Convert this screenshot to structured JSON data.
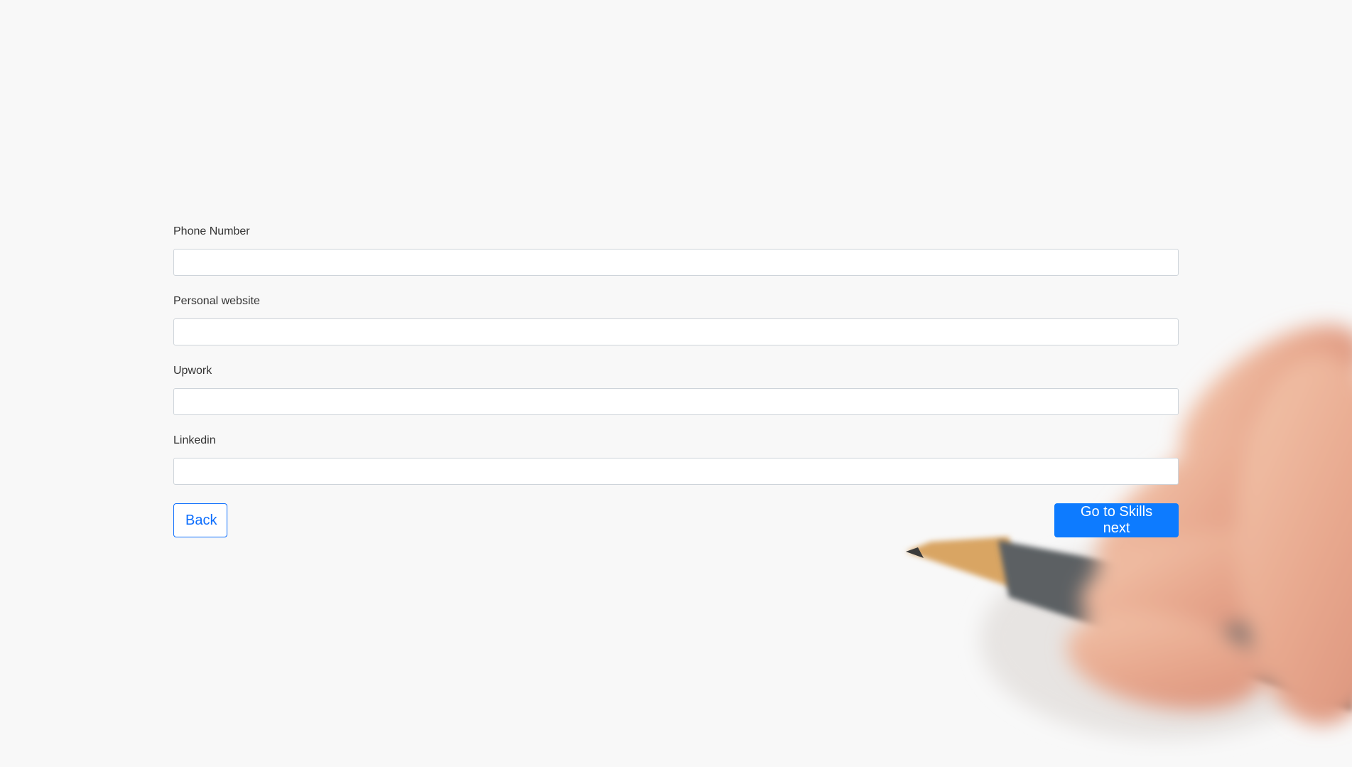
{
  "form": {
    "fields": [
      {
        "label": "Phone Number",
        "value": ""
      },
      {
        "label": "Personal website",
        "value": ""
      },
      {
        "label": "Upwork",
        "value": ""
      },
      {
        "label": "Linkedin",
        "value": ""
      }
    ],
    "back_label": "Back",
    "next_label": "Go to Skills next"
  },
  "colors": {
    "background": "#f8f8f8",
    "primary": "#0d7bff",
    "input_border": "#ced4da"
  }
}
